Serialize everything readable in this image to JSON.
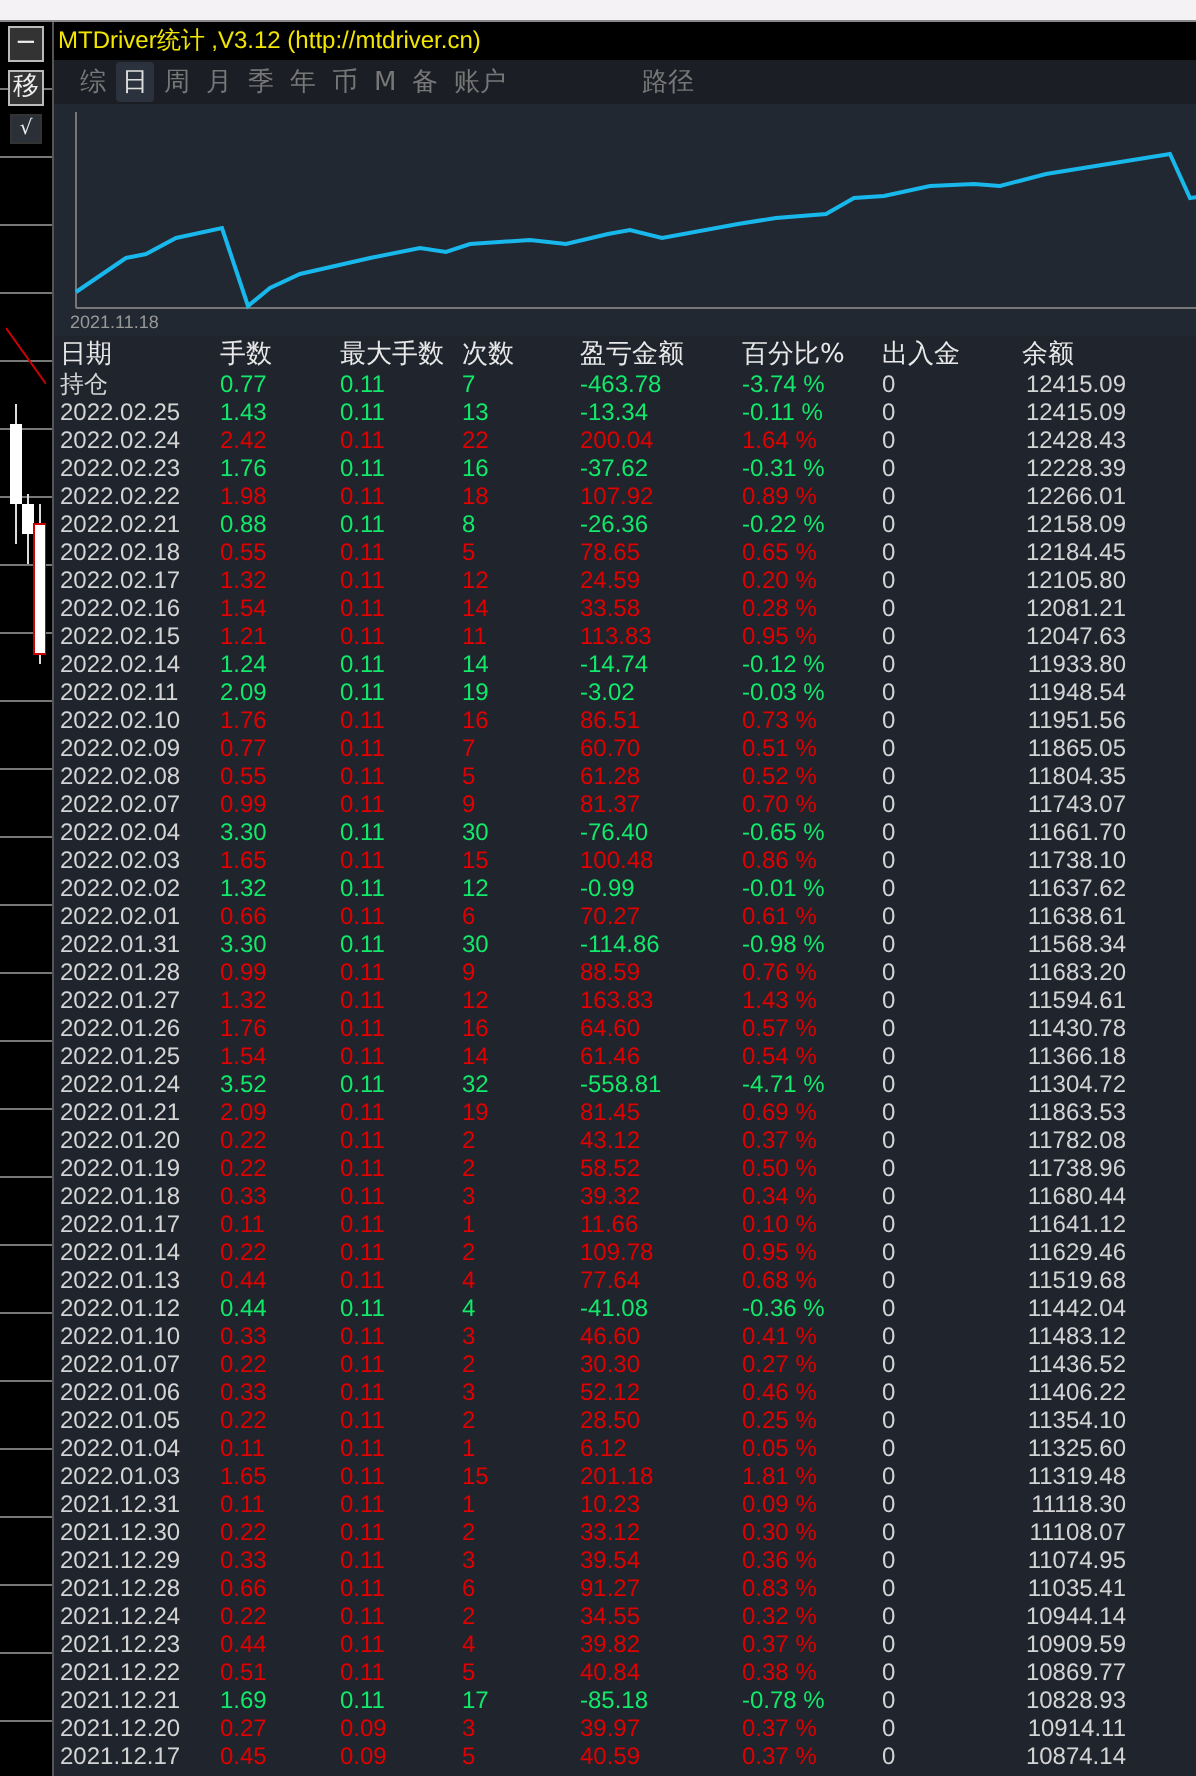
{
  "toolbar": [
    "−",
    "移",
    "√"
  ],
  "window": {
    "title": "MTDriver统计 ,V3.12 (http://mtdriver.cn)"
  },
  "tabs": [
    {
      "label": "综",
      "selected": false
    },
    {
      "label": "日",
      "selected": true
    },
    {
      "label": "周",
      "selected": false
    },
    {
      "label": "月",
      "selected": false
    },
    {
      "label": "季",
      "selected": false
    },
    {
      "label": "年",
      "selected": false
    },
    {
      "label": "币",
      "selected": false
    },
    {
      "label": "M",
      "selected": false
    },
    {
      "label": "备",
      "selected": false
    },
    {
      "label": "账户",
      "selected": false
    }
  ],
  "path_tab": {
    "label": "路径",
    "selected": false
  },
  "chart": {
    "start_label": "2021.11.18"
  },
  "table": {
    "columns": [
      "日期",
      "手数",
      "最大手数",
      "次数",
      "盈亏金额",
      "百分比%",
      "出入金",
      "余额"
    ],
    "rows": [
      {
        "date": "持仓",
        "lots": "0.77",
        "max_lots": "0.11",
        "trades": "7",
        "pnl": "-463.78",
        "percent": "-3.74 %",
        "deposit": "0",
        "balance": "12415.09",
        "kind": "loss"
      },
      {
        "date": "2022.02.25",
        "lots": "1.43",
        "max_lots": "0.11",
        "trades": "13",
        "pnl": "-13.34",
        "percent": "-0.11 %",
        "deposit": "0",
        "balance": "12415.09",
        "kind": "loss"
      },
      {
        "date": "2022.02.24",
        "lots": "2.42",
        "max_lots": "0.11",
        "trades": "22",
        "pnl": "200.04",
        "percent": "1.64 %",
        "deposit": "0",
        "balance": "12428.43",
        "kind": "profit"
      },
      {
        "date": "2022.02.23",
        "lots": "1.76",
        "max_lots": "0.11",
        "trades": "16",
        "pnl": "-37.62",
        "percent": "-0.31 %",
        "deposit": "0",
        "balance": "12228.39",
        "kind": "loss"
      },
      {
        "date": "2022.02.22",
        "lots": "1.98",
        "max_lots": "0.11",
        "trades": "18",
        "pnl": "107.92",
        "percent": "0.89 %",
        "deposit": "0",
        "balance": "12266.01",
        "kind": "profit"
      },
      {
        "date": "2022.02.21",
        "lots": "0.88",
        "max_lots": "0.11",
        "trades": "8",
        "pnl": "-26.36",
        "percent": "-0.22 %",
        "deposit": "0",
        "balance": "12158.09",
        "kind": "loss"
      },
      {
        "date": "2022.02.18",
        "lots": "0.55",
        "max_lots": "0.11",
        "trades": "5",
        "pnl": "78.65",
        "percent": "0.65 %",
        "deposit": "0",
        "balance": "12184.45",
        "kind": "profit"
      },
      {
        "date": "2022.02.17",
        "lots": "1.32",
        "max_lots": "0.11",
        "trades": "12",
        "pnl": "24.59",
        "percent": "0.20 %",
        "deposit": "0",
        "balance": "12105.80",
        "kind": "profit"
      },
      {
        "date": "2022.02.16",
        "lots": "1.54",
        "max_lots": "0.11",
        "trades": "14",
        "pnl": "33.58",
        "percent": "0.28 %",
        "deposit": "0",
        "balance": "12081.21",
        "kind": "profit"
      },
      {
        "date": "2022.02.15",
        "lots": "1.21",
        "max_lots": "0.11",
        "trades": "11",
        "pnl": "113.83",
        "percent": "0.95 %",
        "deposit": "0",
        "balance": "12047.63",
        "kind": "profit"
      },
      {
        "date": "2022.02.14",
        "lots": "1.24",
        "max_lots": "0.11",
        "trades": "14",
        "pnl": "-14.74",
        "percent": "-0.12 %",
        "deposit": "0",
        "balance": "11933.80",
        "kind": "loss"
      },
      {
        "date": "2022.02.11",
        "lots": "2.09",
        "max_lots": "0.11",
        "trades": "19",
        "pnl": "-3.02",
        "percent": "-0.03 %",
        "deposit": "0",
        "balance": "11948.54",
        "kind": "loss"
      },
      {
        "date": "2022.02.10",
        "lots": "1.76",
        "max_lots": "0.11",
        "trades": "16",
        "pnl": "86.51",
        "percent": "0.73 %",
        "deposit": "0",
        "balance": "11951.56",
        "kind": "profit"
      },
      {
        "date": "2022.02.09",
        "lots": "0.77",
        "max_lots": "0.11",
        "trades": "7",
        "pnl": "60.70",
        "percent": "0.51 %",
        "deposit": "0",
        "balance": "11865.05",
        "kind": "profit"
      },
      {
        "date": "2022.02.08",
        "lots": "0.55",
        "max_lots": "0.11",
        "trades": "5",
        "pnl": "61.28",
        "percent": "0.52 %",
        "deposit": "0",
        "balance": "11804.35",
        "kind": "profit"
      },
      {
        "date": "2022.02.07",
        "lots": "0.99",
        "max_lots": "0.11",
        "trades": "9",
        "pnl": "81.37",
        "percent": "0.70 %",
        "deposit": "0",
        "balance": "11743.07",
        "kind": "profit"
      },
      {
        "date": "2022.02.04",
        "lots": "3.30",
        "max_lots": "0.11",
        "trades": "30",
        "pnl": "-76.40",
        "percent": "-0.65 %",
        "deposit": "0",
        "balance": "11661.70",
        "kind": "loss"
      },
      {
        "date": "2022.02.03",
        "lots": "1.65",
        "max_lots": "0.11",
        "trades": "15",
        "pnl": "100.48",
        "percent": "0.86 %",
        "deposit": "0",
        "balance": "11738.10",
        "kind": "profit"
      },
      {
        "date": "2022.02.02",
        "lots": "1.32",
        "max_lots": "0.11",
        "trades": "12",
        "pnl": "-0.99",
        "percent": "-0.01 %",
        "deposit": "0",
        "balance": "11637.62",
        "kind": "loss"
      },
      {
        "date": "2022.02.01",
        "lots": "0.66",
        "max_lots": "0.11",
        "trades": "6",
        "pnl": "70.27",
        "percent": "0.61 %",
        "deposit": "0",
        "balance": "11638.61",
        "kind": "profit"
      },
      {
        "date": "2022.01.31",
        "lots": "3.30",
        "max_lots": "0.11",
        "trades": "30",
        "pnl": "-114.86",
        "percent": "-0.98 %",
        "deposit": "0",
        "balance": "11568.34",
        "kind": "loss"
      },
      {
        "date": "2022.01.28",
        "lots": "0.99",
        "max_lots": "0.11",
        "trades": "9",
        "pnl": "88.59",
        "percent": "0.76 %",
        "deposit": "0",
        "balance": "11683.20",
        "kind": "profit"
      },
      {
        "date": "2022.01.27",
        "lots": "1.32",
        "max_lots": "0.11",
        "trades": "12",
        "pnl": "163.83",
        "percent": "1.43 %",
        "deposit": "0",
        "balance": "11594.61",
        "kind": "profit"
      },
      {
        "date": "2022.01.26",
        "lots": "1.76",
        "max_lots": "0.11",
        "trades": "16",
        "pnl": "64.60",
        "percent": "0.57 %",
        "deposit": "0",
        "balance": "11430.78",
        "kind": "profit"
      },
      {
        "date": "2022.01.25",
        "lots": "1.54",
        "max_lots": "0.11",
        "trades": "14",
        "pnl": "61.46",
        "percent": "0.54 %",
        "deposit": "0",
        "balance": "11366.18",
        "kind": "profit"
      },
      {
        "date": "2022.01.24",
        "lots": "3.52",
        "max_lots": "0.11",
        "trades": "32",
        "pnl": "-558.81",
        "percent": "-4.71 %",
        "deposit": "0",
        "balance": "11304.72",
        "kind": "loss"
      },
      {
        "date": "2022.01.21",
        "lots": "2.09",
        "max_lots": "0.11",
        "trades": "19",
        "pnl": "81.45",
        "percent": "0.69 %",
        "deposit": "0",
        "balance": "11863.53",
        "kind": "profit"
      },
      {
        "date": "2022.01.20",
        "lots": "0.22",
        "max_lots": "0.11",
        "trades": "2",
        "pnl": "43.12",
        "percent": "0.37 %",
        "deposit": "0",
        "balance": "11782.08",
        "kind": "profit"
      },
      {
        "date": "2022.01.19",
        "lots": "0.22",
        "max_lots": "0.11",
        "trades": "2",
        "pnl": "58.52",
        "percent": "0.50 %",
        "deposit": "0",
        "balance": "11738.96",
        "kind": "profit"
      },
      {
        "date": "2022.01.18",
        "lots": "0.33",
        "max_lots": "0.11",
        "trades": "3",
        "pnl": "39.32",
        "percent": "0.34 %",
        "deposit": "0",
        "balance": "11680.44",
        "kind": "profit"
      },
      {
        "date": "2022.01.17",
        "lots": "0.11",
        "max_lots": "0.11",
        "trades": "1",
        "pnl": "11.66",
        "percent": "0.10 %",
        "deposit": "0",
        "balance": "11641.12",
        "kind": "profit"
      },
      {
        "date": "2022.01.14",
        "lots": "0.22",
        "max_lots": "0.11",
        "trades": "2",
        "pnl": "109.78",
        "percent": "0.95 %",
        "deposit": "0",
        "balance": "11629.46",
        "kind": "profit"
      },
      {
        "date": "2022.01.13",
        "lots": "0.44",
        "max_lots": "0.11",
        "trades": "4",
        "pnl": "77.64",
        "percent": "0.68 %",
        "deposit": "0",
        "balance": "11519.68",
        "kind": "profit"
      },
      {
        "date": "2022.01.12",
        "lots": "0.44",
        "max_lots": "0.11",
        "trades": "4",
        "pnl": "-41.08",
        "percent": "-0.36 %",
        "deposit": "0",
        "balance": "11442.04",
        "kind": "loss"
      },
      {
        "date": "2022.01.10",
        "lots": "0.33",
        "max_lots": "0.11",
        "trades": "3",
        "pnl": "46.60",
        "percent": "0.41 %",
        "deposit": "0",
        "balance": "11483.12",
        "kind": "profit"
      },
      {
        "date": "2022.01.07",
        "lots": "0.22",
        "max_lots": "0.11",
        "trades": "2",
        "pnl": "30.30",
        "percent": "0.27 %",
        "deposit": "0",
        "balance": "11436.52",
        "kind": "profit"
      },
      {
        "date": "2022.01.06",
        "lots": "0.33",
        "max_lots": "0.11",
        "trades": "3",
        "pnl": "52.12",
        "percent": "0.46 %",
        "deposit": "0",
        "balance": "11406.22",
        "kind": "profit"
      },
      {
        "date": "2022.01.05",
        "lots": "0.22",
        "max_lots": "0.11",
        "trades": "2",
        "pnl": "28.50",
        "percent": "0.25 %",
        "deposit": "0",
        "balance": "11354.10",
        "kind": "profit"
      },
      {
        "date": "2022.01.04",
        "lots": "0.11",
        "max_lots": "0.11",
        "trades": "1",
        "pnl": "6.12",
        "percent": "0.05 %",
        "deposit": "0",
        "balance": "11325.60",
        "kind": "profit"
      },
      {
        "date": "2022.01.03",
        "lots": "1.65",
        "max_lots": "0.11",
        "trades": "15",
        "pnl": "201.18",
        "percent": "1.81 %",
        "deposit": "0",
        "balance": "11319.48",
        "kind": "profit"
      },
      {
        "date": "2021.12.31",
        "lots": "0.11",
        "max_lots": "0.11",
        "trades": "1",
        "pnl": "10.23",
        "percent": "0.09 %",
        "deposit": "0",
        "balance": "11118.30",
        "kind": "profit"
      },
      {
        "date": "2021.12.30",
        "lots": "0.22",
        "max_lots": "0.11",
        "trades": "2",
        "pnl": "33.12",
        "percent": "0.30 %",
        "deposit": "0",
        "balance": "11108.07",
        "kind": "profit"
      },
      {
        "date": "2021.12.29",
        "lots": "0.33",
        "max_lots": "0.11",
        "trades": "3",
        "pnl": "39.54",
        "percent": "0.36 %",
        "deposit": "0",
        "balance": "11074.95",
        "kind": "profit"
      },
      {
        "date": "2021.12.28",
        "lots": "0.66",
        "max_lots": "0.11",
        "trades": "6",
        "pnl": "91.27",
        "percent": "0.83 %",
        "deposit": "0",
        "balance": "11035.41",
        "kind": "profit"
      },
      {
        "date": "2021.12.24",
        "lots": "0.22",
        "max_lots": "0.11",
        "trades": "2",
        "pnl": "34.55",
        "percent": "0.32 %",
        "deposit": "0",
        "balance": "10944.14",
        "kind": "profit"
      },
      {
        "date": "2021.12.23",
        "lots": "0.44",
        "max_lots": "0.11",
        "trades": "4",
        "pnl": "39.82",
        "percent": "0.37 %",
        "deposit": "0",
        "balance": "10909.59",
        "kind": "profit"
      },
      {
        "date": "2021.12.22",
        "lots": "0.51",
        "max_lots": "0.11",
        "trades": "5",
        "pnl": "40.84",
        "percent": "0.38 %",
        "deposit": "0",
        "balance": "10869.77",
        "kind": "profit"
      },
      {
        "date": "2021.12.21",
        "lots": "1.69",
        "max_lots": "0.11",
        "trades": "17",
        "pnl": "-85.18",
        "percent": "-0.78 %",
        "deposit": "0",
        "balance": "10828.93",
        "kind": "loss"
      },
      {
        "date": "2021.12.20",
        "lots": "0.27",
        "max_lots": "0.09",
        "trades": "3",
        "pnl": "39.97",
        "percent": "0.37 %",
        "deposit": "0",
        "balance": "10914.11",
        "kind": "profit"
      },
      {
        "date": "2021.12.17",
        "lots": "0.45",
        "max_lots": "0.09",
        "trades": "5",
        "pnl": "40.59",
        "percent": "0.37 %",
        "deposit": "0",
        "balance": "10874.14",
        "kind": "profit"
      }
    ]
  }
}
